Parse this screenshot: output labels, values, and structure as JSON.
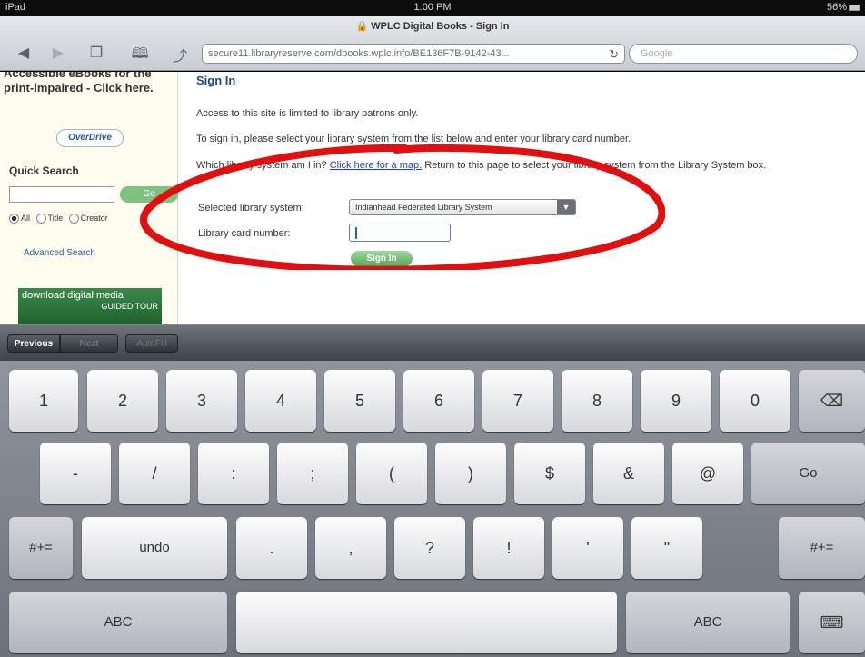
{
  "status_bar": {
    "device": "iPad",
    "wifi_icon": "wifi-icon",
    "time": "1:00 PM",
    "battery": "56%"
  },
  "browser": {
    "page_title": "WPLC Digital Books - Sign In",
    "url": "secure11.libraryreserve.com/dbooks.wplc.info/BE136F7B-9142-43...",
    "search_placeholder": "Google",
    "nav_icons": [
      "back-arrow-icon",
      "forward-arrow-icon",
      "pages-icon",
      "bookmarks-icon",
      "share-icon"
    ]
  },
  "sidebar": {
    "accessible_text": "Accessible eBooks for the print-impaired - Click here.",
    "overdrive_logo": "OverDrive",
    "quick_search_title": "Quick Search",
    "go_label": "Go",
    "radio_options": [
      "All",
      "Title",
      "Creator"
    ],
    "advanced_search": "Advanced Search",
    "banner_title": "download digital media",
    "banner_sub": "GUIDED TOUR"
  },
  "main": {
    "heading": "Sign In",
    "p1": "Access to this site is limited to library patrons only.",
    "p2": "To sign in, please select your library system from the list below and enter your library card number.",
    "p3_start": "Which library system am I in? ",
    "p3_link": "Click here for a map.",
    "p3_end": " Return to this page to select your library system from the Library System box.",
    "label_system": "Selected library system:",
    "selected_system": "Indianhead Federated Library System",
    "label_card": "Library card number:",
    "signin_button": "Sign In"
  },
  "accessory_bar": {
    "previous": "Previous",
    "next": "Next",
    "autofill": "AutoFill"
  },
  "keyboard": {
    "row1": [
      "1",
      "2",
      "3",
      "4",
      "5",
      "6",
      "7",
      "8",
      "9",
      "0"
    ],
    "delete_icon": "backspace-icon",
    "row2": [
      "-",
      "/",
      ":",
      ";",
      "(",
      ")",
      "$",
      "&",
      "@"
    ],
    "go": "Go",
    "shift": "#+=",
    "undo": "undo",
    "row3": [
      ".",
      ",",
      "?",
      "!",
      "'",
      "\""
    ],
    "abc": "ABC",
    "dismiss_icon": "keyboard-dismiss-icon"
  },
  "colors": {
    "annotation_red": "#e01010",
    "link_blue": "#1a3fd6",
    "heading_blue": "#1c4a82"
  }
}
